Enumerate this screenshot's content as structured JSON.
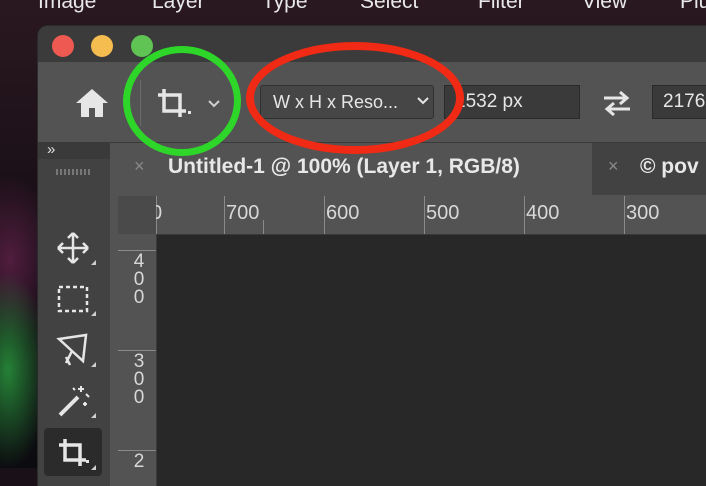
{
  "menubar": {
    "items": [
      "Image",
      "Layer",
      "Type",
      "Select",
      "Filter",
      "View",
      "Plu"
    ]
  },
  "options_bar": {
    "home_icon": "home-icon",
    "crop_tool_icon": "crop-icon",
    "aspect_ratio_select": "W x H x Reso...",
    "width_value": "1532 px",
    "swap_icon": "swap-arrows-icon",
    "height_value": "2176"
  },
  "tool_panel": {
    "collapse_label": "»",
    "tools": [
      "move-icon",
      "marquee-icon",
      "lasso-icon",
      "magic-wand-icon",
      "crop-icon"
    ],
    "active_tool": "crop-icon"
  },
  "tabs": [
    {
      "close": "×",
      "title": "Untitled-1 @ 100% (Layer 1, RGB/8)",
      "active": true
    },
    {
      "close": "×",
      "title": "© pov",
      "active": false
    }
  ],
  "ruler": {
    "horizontal_labels": [
      "0",
      "700",
      "600",
      "500",
      "400",
      "300"
    ],
    "vertical_labels": [
      [
        "4",
        "0",
        "0"
      ],
      [
        "3",
        "0",
        "0"
      ],
      [
        "2"
      ]
    ]
  },
  "annotations": {
    "green_circle_color": "#2ed62a",
    "red_circle_color": "#f02a14"
  }
}
